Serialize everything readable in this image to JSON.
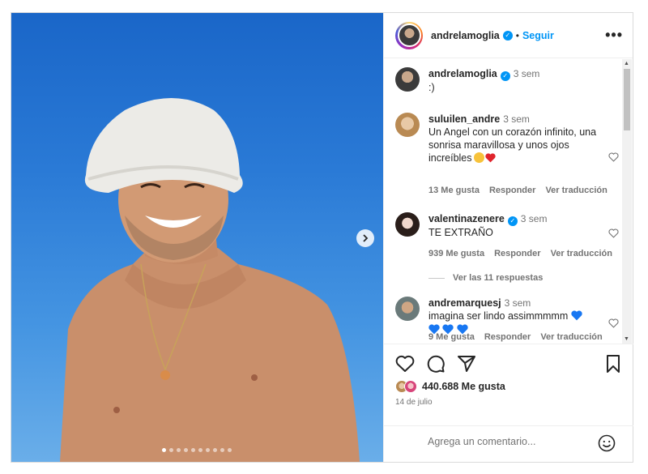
{
  "post": {
    "author": "andrelamoglia",
    "follow_label": "Seguir",
    "separator": "•",
    "more_label": "•••",
    "caption": {
      "username": "andrelamoglia",
      "time": "3 sem",
      "text": ":)"
    },
    "comments": [
      {
        "username": "suluilen_andre",
        "time": "3 sem",
        "text": "Un Angel con un corazón infinito, una sonrisa maravillosa y unos ojos increíbles",
        "likes": "13 Me gusta",
        "reply": "Responder",
        "translate": "Ver traducción"
      },
      {
        "username": "valentinazenere",
        "time": "3 sem",
        "text": "TE EXTRAÑO",
        "likes": "939 Me gusta",
        "reply": "Responder",
        "translate": "Ver traducción",
        "view_replies": "Ver las 11 respuestas"
      },
      {
        "username": "andremarquesj",
        "time": "3 sem",
        "text": "imagina ser lindo assimmmmm",
        "likes": "9 Me gusta",
        "reply": "Responder",
        "translate": "Ver traducción"
      }
    ],
    "likes_count": "440.688 Me gusta",
    "date": "14 de julio",
    "comment_placeholder": "Agrega un comentario...",
    "carousel": {
      "total": 10,
      "active": 1
    }
  },
  "icons": {
    "verified": "verified-badge-icon",
    "like": "heart-icon",
    "comment": "comment-bubble-icon",
    "share": "paper-plane-icon",
    "save": "bookmark-icon",
    "emoji": "smiley-icon",
    "next": "chevron-right-icon"
  },
  "colors": {
    "accent": "#0095f6",
    "heart_red": "#ed4956",
    "blue_heart": "#1877f2",
    "sky": "#2a7ad6"
  }
}
